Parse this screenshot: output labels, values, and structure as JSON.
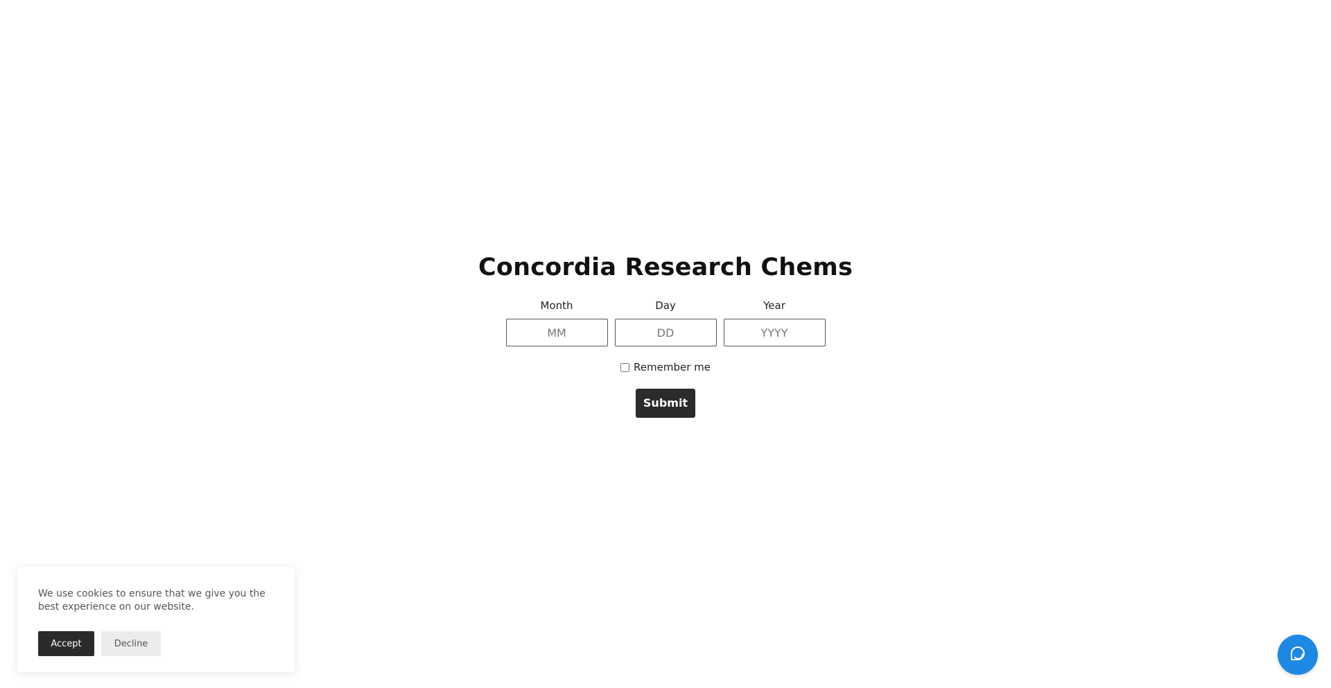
{
  "site": {
    "title": "Concordia Research Chems"
  },
  "age_gate": {
    "month": {
      "label": "Month",
      "placeholder": "MM",
      "value": ""
    },
    "day": {
      "label": "Day",
      "placeholder": "DD",
      "value": ""
    },
    "year": {
      "label": "Year",
      "placeholder": "YYYY",
      "value": ""
    },
    "remember": {
      "label": "Remember me",
      "checked": false
    },
    "submit_label": "Submit"
  },
  "cookie_banner": {
    "message": "We use cookies to ensure that we give you the best experience on our website.",
    "accept_label": "Accept",
    "decline_label": "Decline"
  },
  "chat_launcher": {
    "icon": "chat-bubble-icon",
    "color": "#1e88e5"
  },
  "colors": {
    "primary_button": "#2b2b2b",
    "secondary_button": "#ececec",
    "chat_accent": "#1e88e5"
  }
}
